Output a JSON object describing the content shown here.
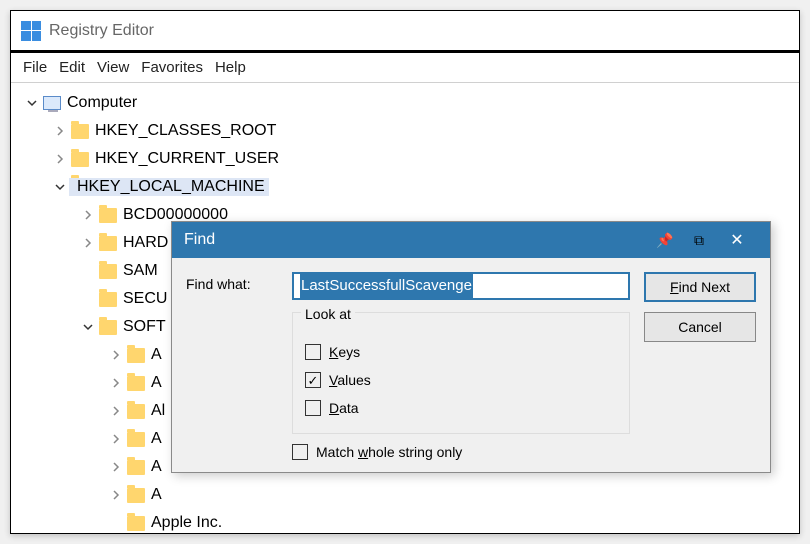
{
  "app": {
    "title": "Registry Editor"
  },
  "menu": {
    "file": "File",
    "edit": "Edit",
    "view": "View",
    "favorites": "Favorites",
    "help": "Help"
  },
  "tree": {
    "root": "Computer",
    "hkcr": "HKEY_CLASSES_ROOT",
    "hkcu": "HKEY_CURRENT_USER",
    "hklm": "HKEY_LOCAL_MACHINE",
    "hklm_children": {
      "bcd": "BCD00000000",
      "hardware": "HARD",
      "sam": "SAM",
      "security": "SECU",
      "software": "SOFT",
      "sw_children": {
        "a1": "A",
        "a2": "A",
        "a3": "Al",
        "a4": "A",
        "a5": "A",
        "a6": "A",
        "apple": "Apple Inc."
      }
    }
  },
  "find": {
    "title": "Find",
    "label_findwhat": "Find what:",
    "value": "LastSuccessfullScavenge",
    "group_label": "Look at",
    "chk_keys": "Keys",
    "chk_values": "Values",
    "chk_data": "Data",
    "chk_match": "Match whole string only",
    "btn_findnext": "Find Next",
    "btn_cancel": "Cancel",
    "keys_checked": false,
    "values_checked": true,
    "data_checked": false,
    "match_checked": false
  },
  "underline": {
    "keys": "K",
    "values": "V",
    "data": "D",
    "match": "w",
    "findnext": "F"
  }
}
